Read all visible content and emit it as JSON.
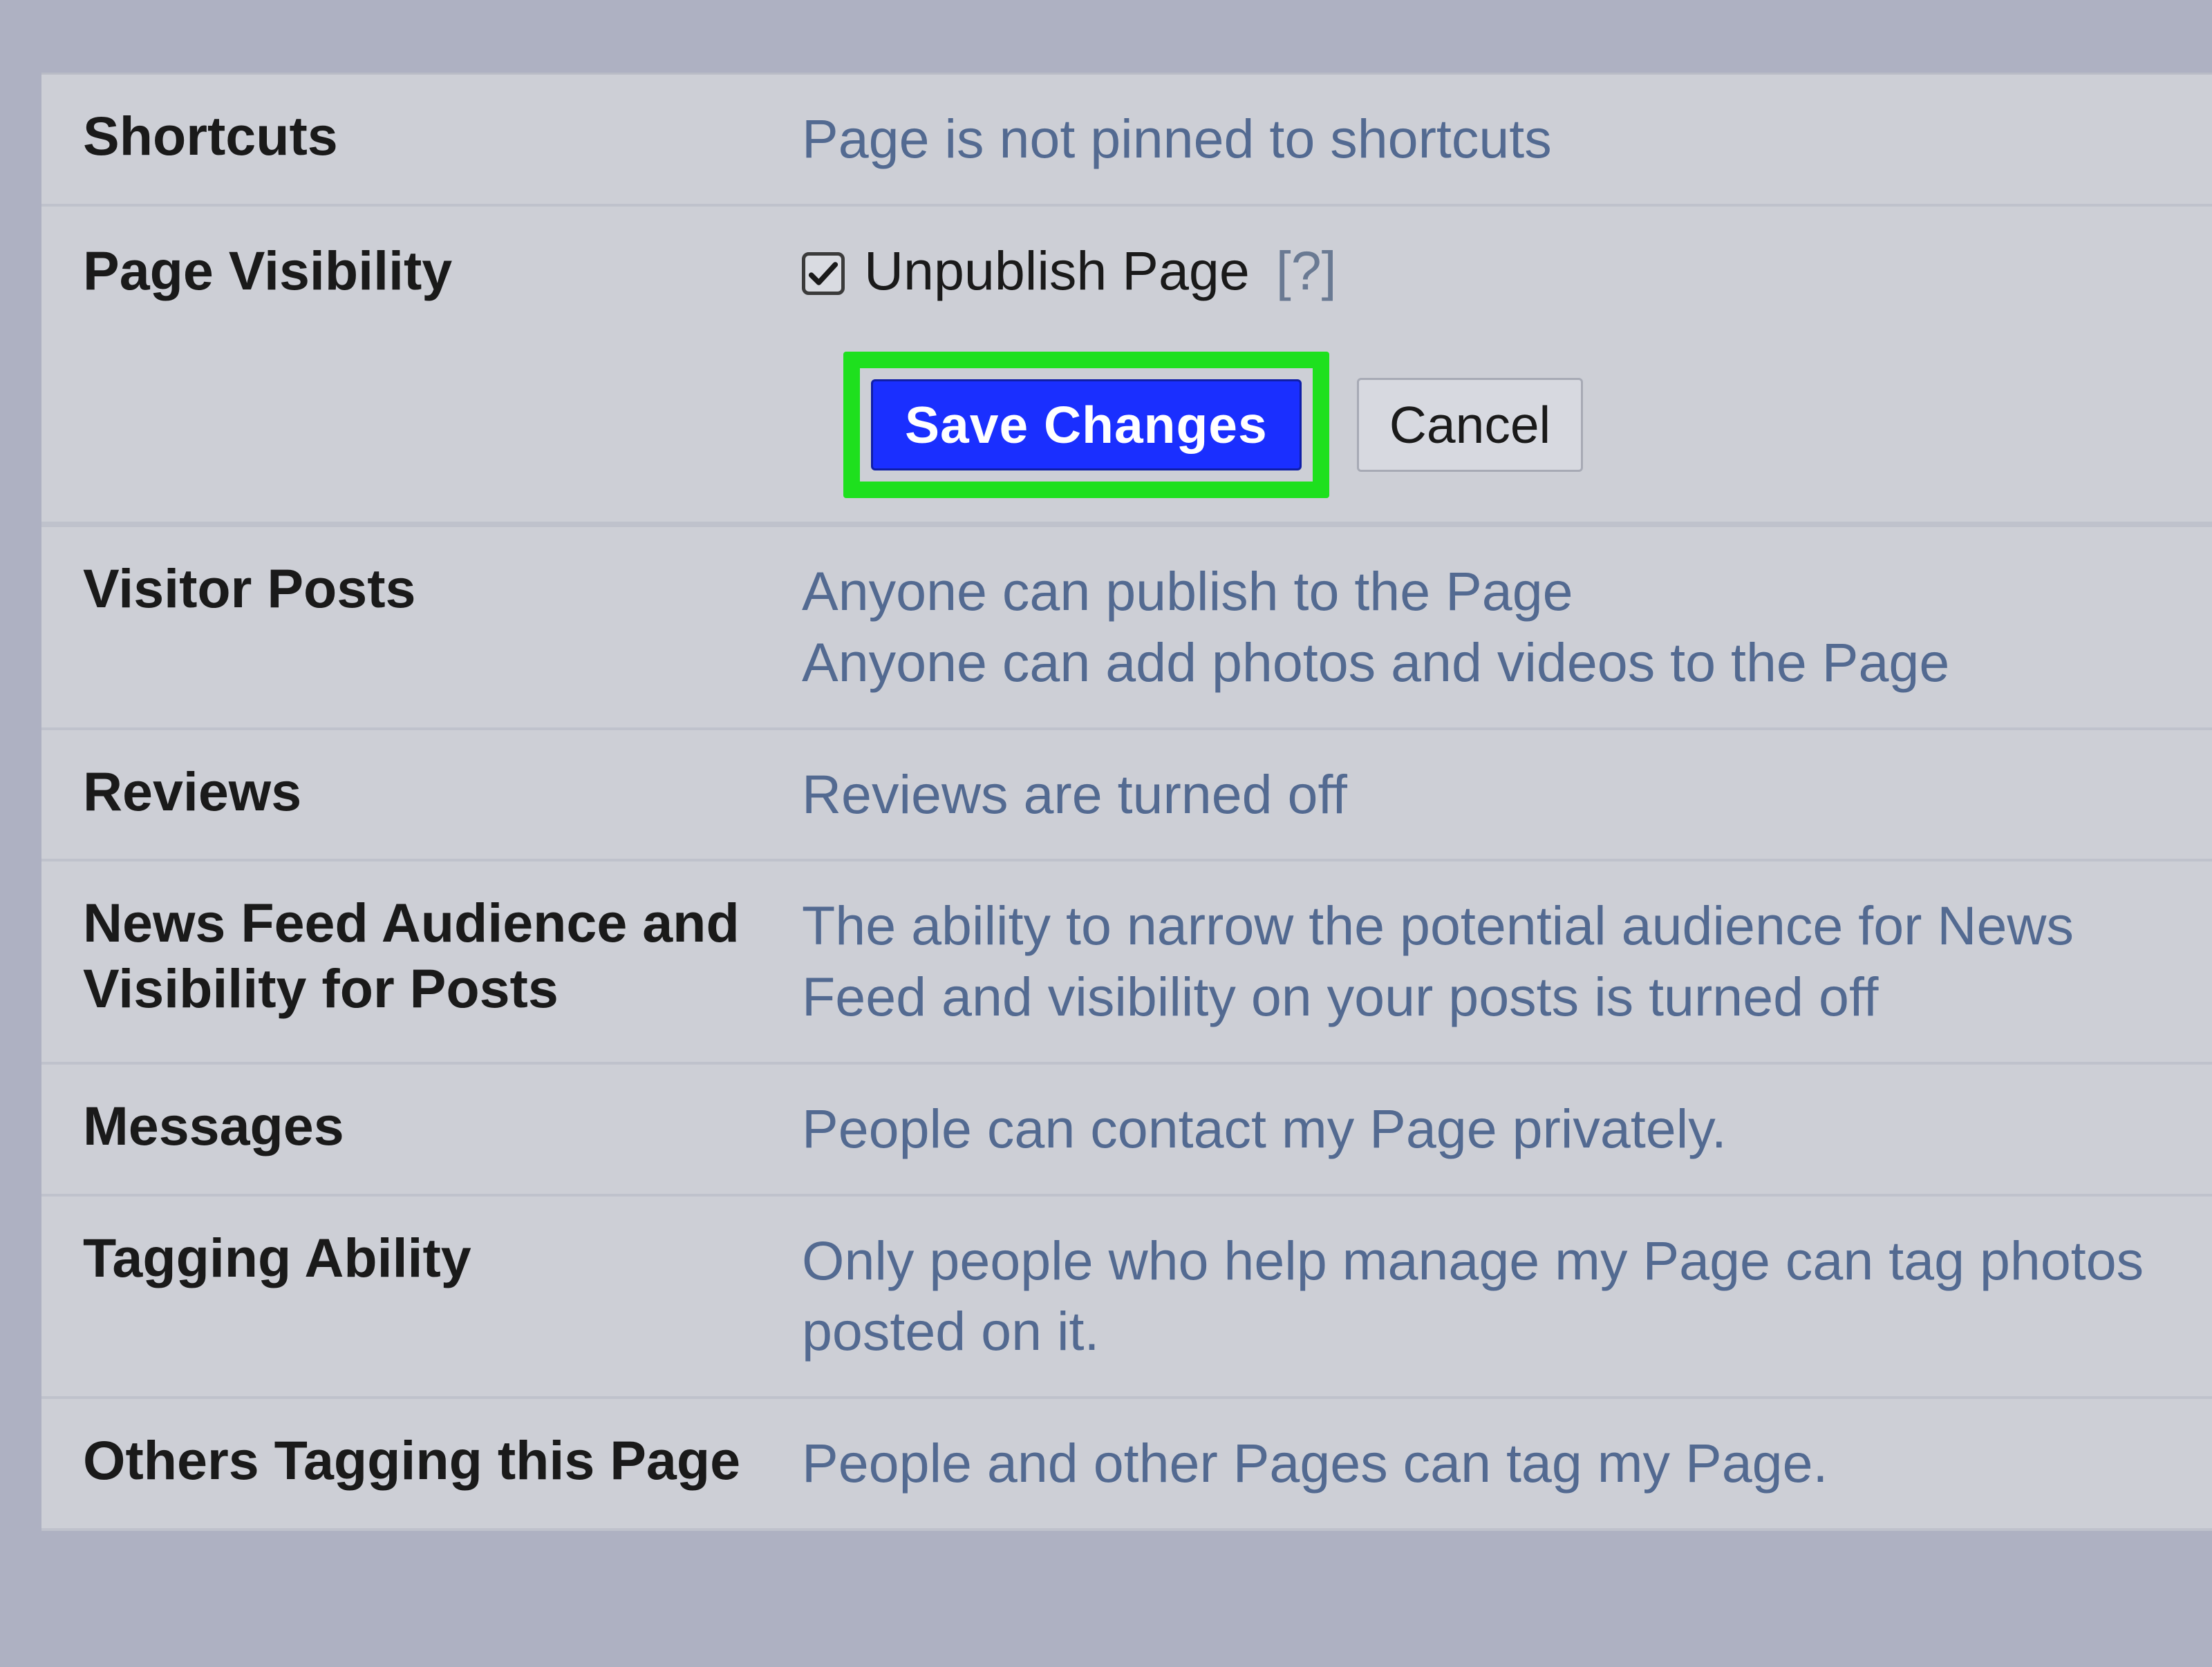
{
  "settings": {
    "shortcuts": {
      "label": "Shortcuts",
      "value": "Page is not pinned to shortcuts"
    },
    "page_visibility": {
      "label": "Page Visibility",
      "checkbox_label": "Unpublish Page",
      "help_marker": "[?]",
      "checked": true,
      "save_label": "Save Changes",
      "cancel_label": "Cancel"
    },
    "visitor_posts": {
      "label": "Visitor Posts",
      "line1": "Anyone can publish to the Page",
      "line2": "Anyone can add photos and videos to the Page"
    },
    "reviews": {
      "label": "Reviews",
      "value": "Reviews are turned off"
    },
    "news_feed": {
      "label": "News Feed Audience and Visibility for Posts",
      "value": "The ability to narrow the potential audience for News Feed and visibility on your posts is turned off"
    },
    "messages": {
      "label": "Messages",
      "value": "People can contact my Page privately."
    },
    "tagging": {
      "label": "Tagging Ability",
      "value": "Only people who help manage my Page can tag photos posted on it."
    },
    "others_tagging": {
      "label": "Others Tagging this Page",
      "value": "People and other Pages can tag my Page."
    }
  }
}
